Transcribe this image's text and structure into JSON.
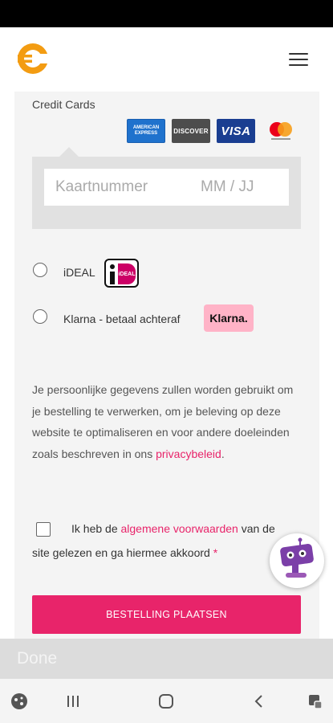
{
  "header": {
    "logo_icon": "euro-coin-logo",
    "menu_icon": "hamburger-menu-icon"
  },
  "payment": {
    "credit_cards_title": "Credit Cards",
    "card_brands": {
      "amex_line1": "AMERICAN",
      "amex_line2": "EXPRESS",
      "discover": "DISCOVER",
      "visa": "VISA",
      "mastercard_icon": "mastercard-logo"
    },
    "card_number_placeholder": "Kaartnummer",
    "expiry_placeholder": "MM / JJ",
    "ideal_label": "iDEAL",
    "ideal_logo_text": "iDEAL",
    "klarna_label": "Klarna - betaal achteraf",
    "klarna_logo_text": "Klarna."
  },
  "privacy": {
    "text": "Je persoonlijke gegevens zullen worden gebruikt om je bestelling te verwerken, om je beleving op deze website te optimaliseren en voor andere doeleinden zoals beschreven in ons ",
    "link": "privacybeleid",
    "end": "."
  },
  "terms": {
    "prefix": "Ik heb de ",
    "link": "algemene voorwaarden",
    "suffix": " van de site gelezen en ga hiermee akkoord ",
    "required_mark": "*"
  },
  "order_button_label": "BESTELLING PLAATSEN",
  "keyboard_bar": {
    "done_label": "Done"
  },
  "colors": {
    "accent": "#e8246a",
    "logo_orange": "#f39c12",
    "panel_bg": "#f4f4f4"
  }
}
